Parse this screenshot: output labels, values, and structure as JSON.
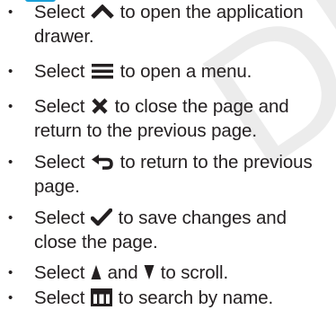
{
  "watermark": {
    "text": "DRAFT"
  },
  "items": [
    {
      "icon": "chevron-up-icon",
      "before": "Select",
      "after": "to open the application drawer."
    },
    {
      "icon": "menu-icon",
      "before": "Select",
      "after": "to open a menu."
    },
    {
      "icon": "close-icon",
      "before": "Select",
      "after": "to close the page and return to the previous page."
    },
    {
      "icon": "back-icon",
      "before": "Select",
      "after": "to return to the previous page."
    },
    {
      "icon": "checkmark-icon",
      "before": "Select",
      "after": "to save changes and close the page."
    },
    {
      "icon": "arrow-up-icon",
      "icon2": "arrow-down-icon",
      "before": "Select",
      "middle": "and",
      "after": "to scroll."
    },
    {
      "icon": "search-name-icon",
      "before": "Select",
      "after": "to search by name."
    }
  ],
  "bullet_symbol": "•"
}
